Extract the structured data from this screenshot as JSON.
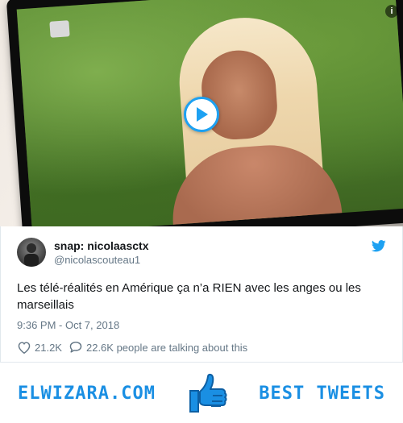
{
  "video": {
    "icons": {
      "play": "play-icon",
      "info": "info-icon",
      "channel_logo": "mtv-logo-icon"
    },
    "accent_color": "#1da1f2"
  },
  "tweet": {
    "display_name": "snap: nicolaasctx",
    "handle": "@nicolascouteau1",
    "text": "Les télé-réalités en Amérique ça n’a RIEN avec les anges ou les marseillais",
    "timestamp": "9:36 PM - Oct 7, 2018",
    "likes": "21.2K",
    "replies_text": "22.6K people are talking about this",
    "icons": {
      "avatar": "avatar",
      "brand": "twitter-bird-icon",
      "like": "heart-icon",
      "reply": "comment-icon"
    }
  },
  "banner": {
    "left_text": "ELWIZARA.COM",
    "right_text": "BEST TWEETS",
    "icon": "thumbs-up-icon",
    "color": "#1a8fe3"
  }
}
